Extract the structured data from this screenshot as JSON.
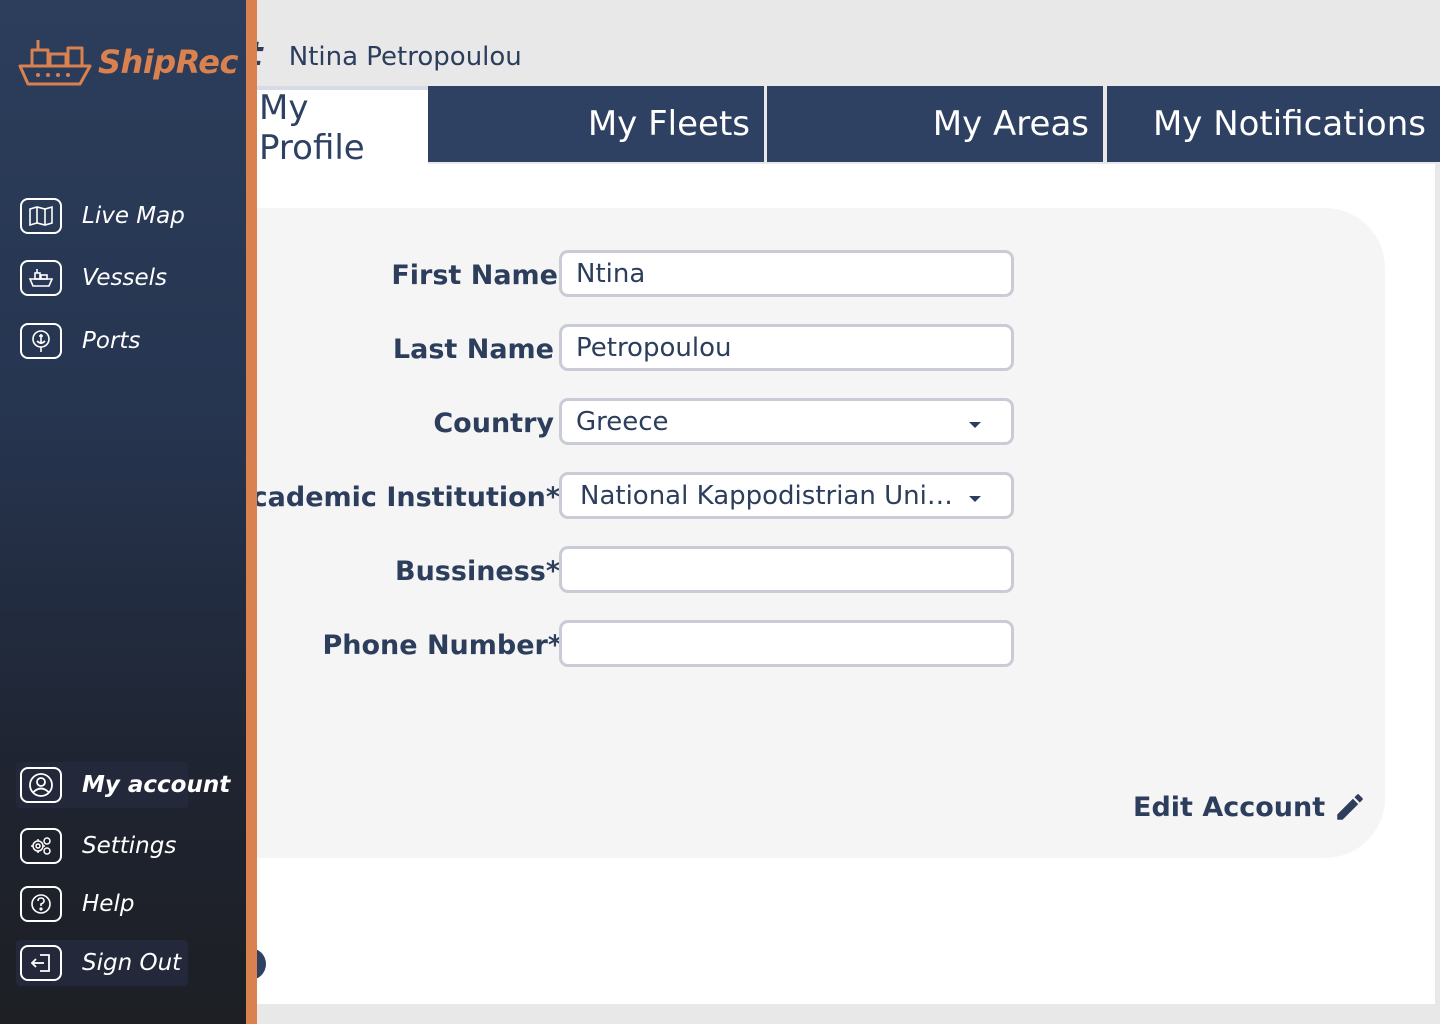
{
  "app": {
    "name": "ShipRec"
  },
  "header": {
    "title": "unt",
    "user_name": "Ntina Petropoulou"
  },
  "tabs": [
    {
      "label": "My Profile",
      "active": true
    },
    {
      "label": "My Fleets",
      "active": false
    },
    {
      "label": "My Areas",
      "active": false
    },
    {
      "label": "My Notifications",
      "active": false
    }
  ],
  "profile": {
    "first_name": {
      "label": "First Name",
      "value": "Ntina"
    },
    "last_name": {
      "label": "Last Name",
      "value": "Petropoulou"
    },
    "country": {
      "label": "Country",
      "value": "Greece"
    },
    "institution": {
      "label": "cademic Institution*",
      "value": "National Kappodistrian Univer..."
    },
    "business": {
      "label": "Bussiness*",
      "value": ""
    },
    "phone": {
      "label": "Phone Number*",
      "value": ""
    },
    "edit_label": "Edit Account"
  },
  "sidebar": {
    "top": [
      {
        "label": "Live Map",
        "icon": "map-icon"
      },
      {
        "label": "Vessels",
        "icon": "ship-icon"
      },
      {
        "label": "Ports",
        "icon": "port-icon"
      }
    ],
    "bottom": [
      {
        "label": "My account",
        "icon": "user-icon",
        "active": true
      },
      {
        "label": "Settings",
        "icon": "gear-icon"
      },
      {
        "label": "Help",
        "icon": "help-icon"
      },
      {
        "label": "Sign Out",
        "icon": "sign-out-icon"
      }
    ]
  },
  "colors": {
    "navy": "#2e4163",
    "accent": "#d9814f",
    "text": "#2c3e5c",
    "card": "#f5f5f5"
  }
}
